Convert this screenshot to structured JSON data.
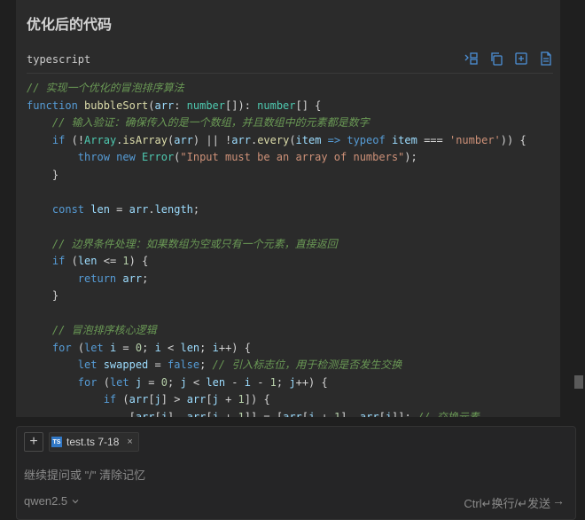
{
  "title": "优化后的代码",
  "code_block": {
    "language": "typescript",
    "actions": [
      {
        "name": "insert-code-icon"
      },
      {
        "name": "copy-icon"
      },
      {
        "name": "new-file-icon"
      },
      {
        "name": "apply-file-icon"
      }
    ],
    "lines": [
      [
        [
          "c-com",
          "// 实现一个优化的冒泡排序算法"
        ]
      ],
      [
        [
          "c-kw",
          "function "
        ],
        [
          "c-fn",
          "bubbleSort"
        ],
        [
          "c-tx",
          "("
        ],
        [
          "c-var",
          "arr"
        ],
        [
          "c-tx",
          ": "
        ],
        [
          "c-ty",
          "number"
        ],
        [
          "c-tx",
          "[]): "
        ],
        [
          "c-ty",
          "number"
        ],
        [
          "c-tx",
          "[] {"
        ]
      ],
      [
        [
          "c-tx",
          "    "
        ],
        [
          "c-com",
          "// 输入验证：确保传入的是一个数组，并且数组中的元素都是数字"
        ]
      ],
      [
        [
          "c-tx",
          "    "
        ],
        [
          "c-kw",
          "if "
        ],
        [
          "c-tx",
          "(!"
        ],
        [
          "c-ty",
          "Array"
        ],
        [
          "c-tx",
          "."
        ],
        [
          "c-fn",
          "isArray"
        ],
        [
          "c-tx",
          "("
        ],
        [
          "c-var",
          "arr"
        ],
        [
          "c-tx",
          ") || !"
        ],
        [
          "c-var",
          "arr"
        ],
        [
          "c-tx",
          "."
        ],
        [
          "c-fn",
          "every"
        ],
        [
          "c-tx",
          "("
        ],
        [
          "c-var",
          "item"
        ],
        [
          "c-kw",
          " => "
        ],
        [
          "c-kw",
          "typeof "
        ],
        [
          "c-var",
          "item"
        ],
        [
          "c-tx",
          " === "
        ],
        [
          "c-str",
          "'number'"
        ],
        [
          "c-tx",
          ")) {"
        ]
      ],
      [
        [
          "c-tx",
          "        "
        ],
        [
          "c-kw",
          "throw new "
        ],
        [
          "c-ty",
          "Error"
        ],
        [
          "c-tx",
          "("
        ],
        [
          "c-str",
          "\"Input must be an array of numbers\""
        ],
        [
          "c-tx",
          ");"
        ]
      ],
      [
        [
          "c-tx",
          "    }"
        ]
      ],
      [
        [
          "c-tx",
          ""
        ]
      ],
      [
        [
          "c-tx",
          "    "
        ],
        [
          "c-kw",
          "const "
        ],
        [
          "c-var",
          "len"
        ],
        [
          "c-tx",
          " = "
        ],
        [
          "c-var",
          "arr"
        ],
        [
          "c-tx",
          "."
        ],
        [
          "c-var",
          "length"
        ],
        [
          "c-tx",
          ";"
        ]
      ],
      [
        [
          "c-tx",
          ""
        ]
      ],
      [
        [
          "c-tx",
          "    "
        ],
        [
          "c-com",
          "// 边界条件处理：如果数组为空或只有一个元素，直接返回"
        ]
      ],
      [
        [
          "c-tx",
          "    "
        ],
        [
          "c-kw",
          "if "
        ],
        [
          "c-tx",
          "("
        ],
        [
          "c-var",
          "len"
        ],
        [
          "c-tx",
          " <= "
        ],
        [
          "c-num",
          "1"
        ],
        [
          "c-tx",
          ") {"
        ]
      ],
      [
        [
          "c-tx",
          "        "
        ],
        [
          "c-kw",
          "return "
        ],
        [
          "c-var",
          "arr"
        ],
        [
          "c-tx",
          ";"
        ]
      ],
      [
        [
          "c-tx",
          "    }"
        ]
      ],
      [
        [
          "c-tx",
          ""
        ]
      ],
      [
        [
          "c-tx",
          "    "
        ],
        [
          "c-com",
          "// 冒泡排序核心逻辑"
        ]
      ],
      [
        [
          "c-tx",
          "    "
        ],
        [
          "c-kw",
          "for "
        ],
        [
          "c-tx",
          "("
        ],
        [
          "c-kw",
          "let "
        ],
        [
          "c-var",
          "i"
        ],
        [
          "c-tx",
          " = "
        ],
        [
          "c-num",
          "0"
        ],
        [
          "c-tx",
          "; "
        ],
        [
          "c-var",
          "i"
        ],
        [
          "c-tx",
          " < "
        ],
        [
          "c-var",
          "len"
        ],
        [
          "c-tx",
          "; "
        ],
        [
          "c-var",
          "i"
        ],
        [
          "c-tx",
          "++) {"
        ]
      ],
      [
        [
          "c-tx",
          "        "
        ],
        [
          "c-kw",
          "let "
        ],
        [
          "c-var",
          "swapped"
        ],
        [
          "c-tx",
          " = "
        ],
        [
          "c-kw",
          "false"
        ],
        [
          "c-tx",
          "; "
        ],
        [
          "c-com",
          "// 引入标志位，用于检测是否发生交换"
        ]
      ],
      [
        [
          "c-tx",
          "        "
        ],
        [
          "c-kw",
          "for "
        ],
        [
          "c-tx",
          "("
        ],
        [
          "c-kw",
          "let "
        ],
        [
          "c-var",
          "j"
        ],
        [
          "c-tx",
          " = "
        ],
        [
          "c-num",
          "0"
        ],
        [
          "c-tx",
          "; "
        ],
        [
          "c-var",
          "j"
        ],
        [
          "c-tx",
          " < "
        ],
        [
          "c-var",
          "len"
        ],
        [
          "c-tx",
          " - "
        ],
        [
          "c-var",
          "i"
        ],
        [
          "c-tx",
          " - "
        ],
        [
          "c-num",
          "1"
        ],
        [
          "c-tx",
          "; "
        ],
        [
          "c-var",
          "j"
        ],
        [
          "c-tx",
          "++) {"
        ]
      ],
      [
        [
          "c-tx",
          "            "
        ],
        [
          "c-kw",
          "if "
        ],
        [
          "c-tx",
          "("
        ],
        [
          "c-var",
          "arr"
        ],
        [
          "c-tx",
          "["
        ],
        [
          "c-var",
          "j"
        ],
        [
          "c-tx",
          "] > "
        ],
        [
          "c-var",
          "arr"
        ],
        [
          "c-tx",
          "["
        ],
        [
          "c-var",
          "j"
        ],
        [
          "c-tx",
          " + "
        ],
        [
          "c-num",
          "1"
        ],
        [
          "c-tx",
          "]) {"
        ]
      ],
      [
        [
          "c-tx",
          "                ["
        ],
        [
          "c-var",
          "arr"
        ],
        [
          "c-tx",
          "["
        ],
        [
          "c-var",
          "j"
        ],
        [
          "c-tx",
          "], "
        ],
        [
          "c-var",
          "arr"
        ],
        [
          "c-tx",
          "["
        ],
        [
          "c-var",
          "j"
        ],
        [
          "c-tx",
          " + "
        ],
        [
          "c-num",
          "1"
        ],
        [
          "c-tx",
          "]] = ["
        ],
        [
          "c-var",
          "arr"
        ],
        [
          "c-tx",
          "["
        ],
        [
          "c-var",
          "j"
        ],
        [
          "c-tx",
          " + "
        ],
        [
          "c-num",
          "1"
        ],
        [
          "c-tx",
          "], "
        ],
        [
          "c-var",
          "arr"
        ],
        [
          "c-tx",
          "["
        ],
        [
          "c-var",
          "j"
        ],
        [
          "c-tx",
          "]]; "
        ],
        [
          "c-com",
          "// 交换元素"
        ]
      ]
    ]
  },
  "input_area": {
    "add_button": "+",
    "file_chip": {
      "icon_text": "TS",
      "label": "test.ts 7-18",
      "close": "×"
    },
    "placeholder": "继续提问或 \"/\" 清除记忆",
    "model": "qwen2.5",
    "hint": "Ctrl↵换行/↵发送",
    "send": "→"
  },
  "colors": {
    "background": "#1f1f1f",
    "panel": "#2b2b2b",
    "accent": "#4c8fd6"
  }
}
